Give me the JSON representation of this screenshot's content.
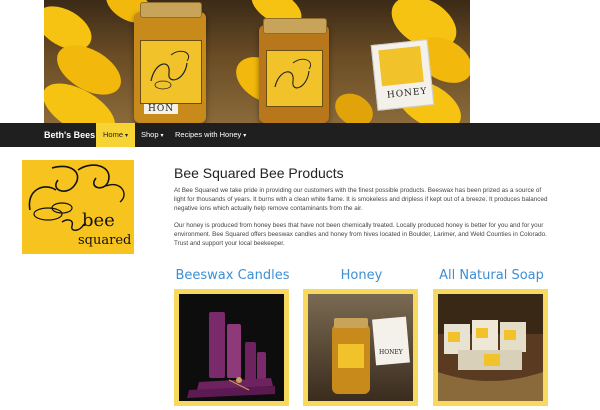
{
  "hero": {
    "jar_label": "HONEY",
    "jar_label_partial": "HON"
  },
  "navbar": {
    "brand": "Beth's Bees",
    "items": [
      {
        "label": "Home",
        "caret": "▾",
        "active": true
      },
      {
        "label": "Shop",
        "caret": "▾",
        "active": false
      },
      {
        "label": "Recipes with Honey",
        "caret": "▾",
        "active": false
      }
    ]
  },
  "logo": {
    "text": "bee squared"
  },
  "main": {
    "title": "Bee Squared Bee Products",
    "paragraphs": [
      "At Bee Squared we take pride in providing our customers with the finest possible products. Beeswax has been prized as a source of light for thousands of years. It burns with a clean white flame. It is smokeless and dripless if kept out of a breeze. It produces balanced negative ions which actually help remove contaminants from the air.",
      "Our honey is produced from honey bees that have not been chemically treated. Locally produced honey is better for you and for your environment. Bee Squared offers beeswax candles and honey from hives located in Boulder, Larimer, and Weld Counties in Colorado. Trust and support your local beekeeper."
    ]
  },
  "products": [
    {
      "title": "Beeswax Candles"
    },
    {
      "title": "Honey",
      "jar_label": "HONEY"
    },
    {
      "title": "All Natural Soap"
    }
  ],
  "colors": {
    "navbar_bg": "#1f1f1f",
    "active_nav": "#f7d436",
    "product_title": "#3d8fd6",
    "frame": "#f7d95d",
    "logo_bg": "#f7c41f"
  }
}
